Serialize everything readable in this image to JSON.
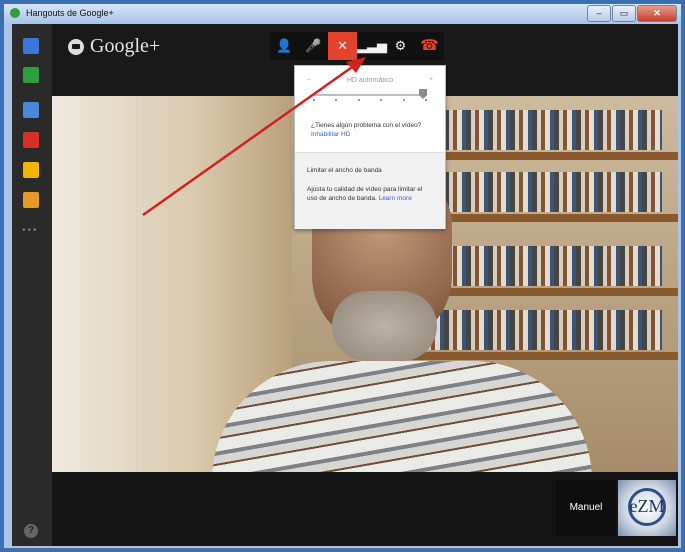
{
  "window": {
    "title": "Hangouts de Google+",
    "min_label": "–",
    "max_label": "▭",
    "close_label": "✕"
  },
  "app": {
    "logo_text": "Google+"
  },
  "rail": {
    "items": [
      {
        "name": "chat",
        "color": "#3a77d8"
      },
      {
        "name": "screenshare",
        "color": "#2e9e3f"
      },
      {
        "name": "camera",
        "color": "#4a88d9"
      },
      {
        "name": "youtube",
        "color": "#d93025"
      },
      {
        "name": "drive",
        "color": "#f3b400"
      },
      {
        "name": "photos",
        "color": "#e59a23"
      }
    ],
    "more_label": "•••",
    "help_label": "?"
  },
  "toolbar": {
    "invite_icon": "👤",
    "mic_icon": "🎤",
    "camera_icon": "✕",
    "bandwidth_icon": "▂▃▅",
    "settings_icon": "⚙",
    "hangup_icon": "☎"
  },
  "popup": {
    "hd_label": "HD automático",
    "minus": "–",
    "plus": "+",
    "question": "¿Tienes algún problema con el vídeo?",
    "disable_hd": "Inhabilitar HD",
    "limit_title": "Limitar el ancho de banda",
    "limit_desc": "Ajusta tu calidad de vídeo para limitar el uso de ancho de banda.",
    "learn_more": "Learn more"
  },
  "participants": [
    {
      "name": "Manuel",
      "thumb_label": "eZM"
    }
  ],
  "colors": {
    "accent_red": "#e3422f",
    "link_blue": "#3b5fc7",
    "arrow": "#d41f1f"
  }
}
